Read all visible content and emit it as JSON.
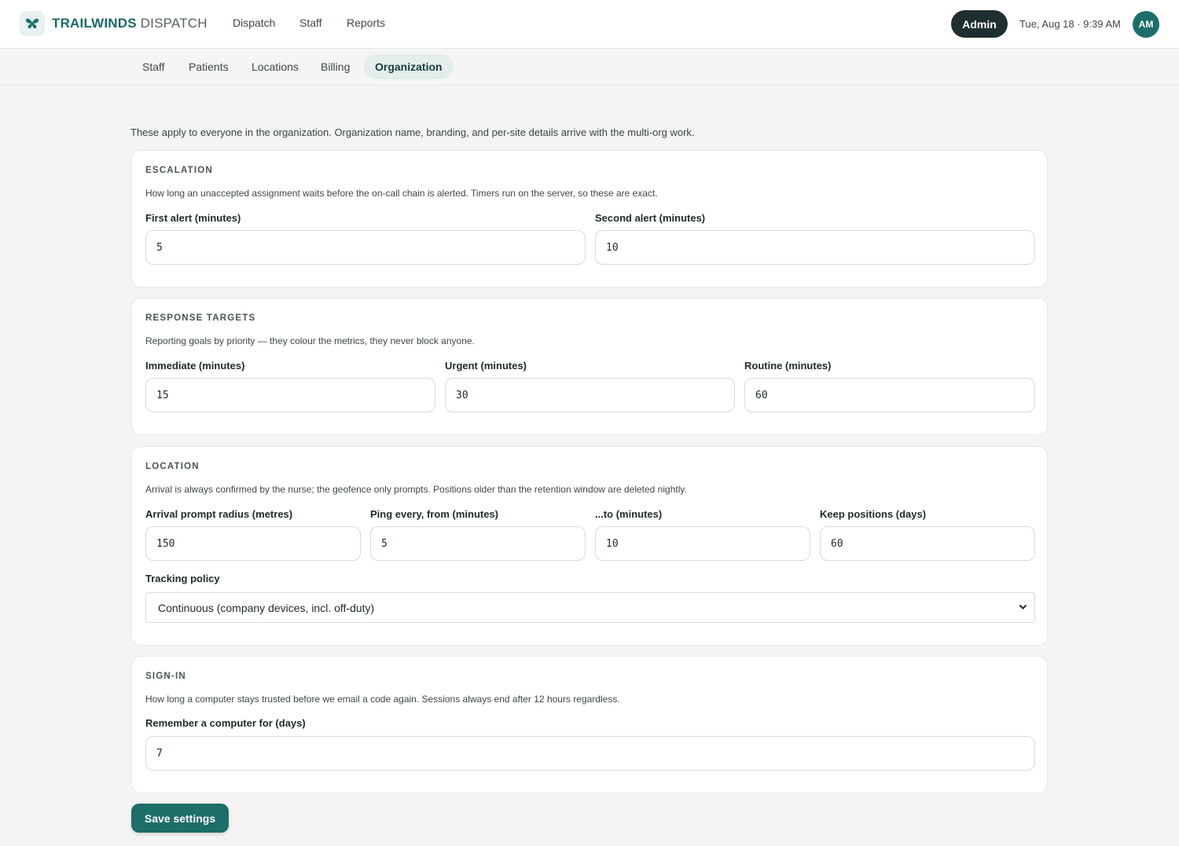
{
  "header": {
    "brand_primary": "TRAILWINDS",
    "brand_secondary": " DISPATCH",
    "nav": [
      "Dispatch",
      "Staff",
      "Reports"
    ],
    "role": "Admin",
    "datetime": "Tue, Aug 18 · 9:39 AM",
    "avatar_initials": "AM"
  },
  "subnav": {
    "tabs": [
      "Staff",
      "Patients",
      "Locations",
      "Billing",
      "Organization"
    ],
    "active": "Organization"
  },
  "intro": "These apply to everyone in the organization. Organization name, branding, and per-site details arrive with the multi-org work.",
  "escalation": {
    "title": "ESCALATION",
    "description": "How long an unaccepted assignment waits before the on-call chain is alerted. Timers run on the server, so these are exact.",
    "first_label": "First alert (minutes)",
    "first_value": "5",
    "second_label": "Second alert (minutes)",
    "second_value": "10"
  },
  "targets": {
    "title": "RESPONSE TARGETS",
    "description": "Reporting goals by priority — they colour the metrics, they never block anyone.",
    "immediate_label": "Immediate (minutes)",
    "immediate_value": "15",
    "urgent_label": "Urgent (minutes)",
    "urgent_value": "30",
    "routine_label": "Routine (minutes)",
    "routine_value": "60"
  },
  "location": {
    "title": "LOCATION",
    "description": "Arrival is always confirmed by the nurse; the geofence only prompts. Positions older than the retention window are deleted nightly.",
    "radius_label": "Arrival prompt radius (metres)",
    "radius_value": "150",
    "ping_from_label": "Ping every, from (minutes)",
    "ping_from_value": "5",
    "ping_to_label": "...to (minutes)",
    "ping_to_value": "10",
    "keep_label": "Keep positions (days)",
    "keep_value": "60",
    "policy_label": "Tracking policy",
    "policy_value": "Continuous (company devices, incl. off-duty)"
  },
  "signin": {
    "title": "SIGN-IN",
    "description": "How long a computer stays trusted before we email a code again. Sessions always end after 12 hours regardless.",
    "remember_label": "Remember a computer for (days)",
    "remember_value": "7"
  },
  "save_label": "Save settings",
  "colors": {
    "accent": "#1d6e68",
    "admin_pill": "#1f2f2f",
    "active_tab_bg": "#e3eeec"
  }
}
